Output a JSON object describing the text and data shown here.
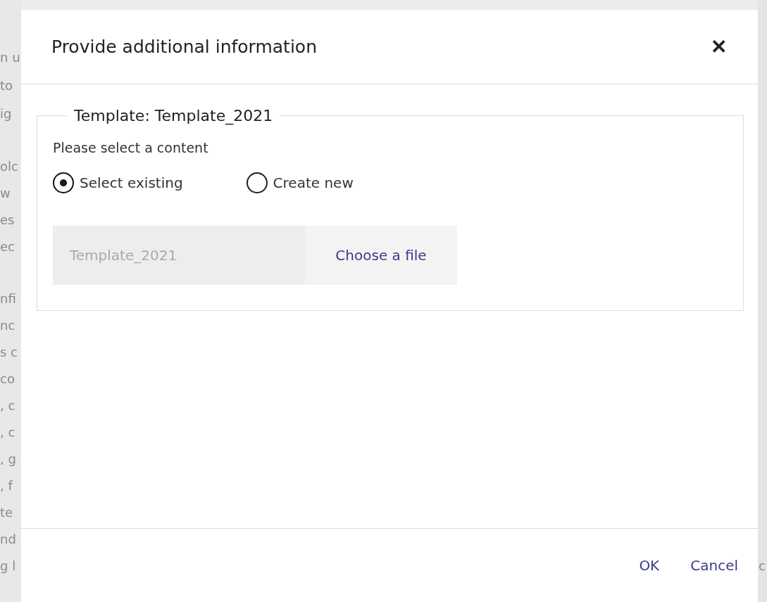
{
  "background_text": [
    [
      "n u",
      "to",
      "ig"
    ],
    [
      "olc",
      "w",
      "es",
      "ec"
    ],
    [
      "nfi",
      "nc",
      "s c",
      "co",
      ", c",
      ", c",
      ", g",
      ", f",
      "te",
      "nd",
      "g l"
    ]
  ],
  "background_right_text": "c",
  "dialog": {
    "title": "Provide additional information",
    "close": "✕",
    "fieldset": {
      "legend": "Template: Template_2021",
      "prompt": "Please select a content",
      "options": [
        {
          "label": "Select existing",
          "selected": true
        },
        {
          "label": "Create new",
          "selected": false
        }
      ],
      "file": {
        "placeholder": "Template_2021",
        "button": "Choose a file"
      }
    },
    "buttons": [
      "OK",
      "Cancel"
    ]
  }
}
